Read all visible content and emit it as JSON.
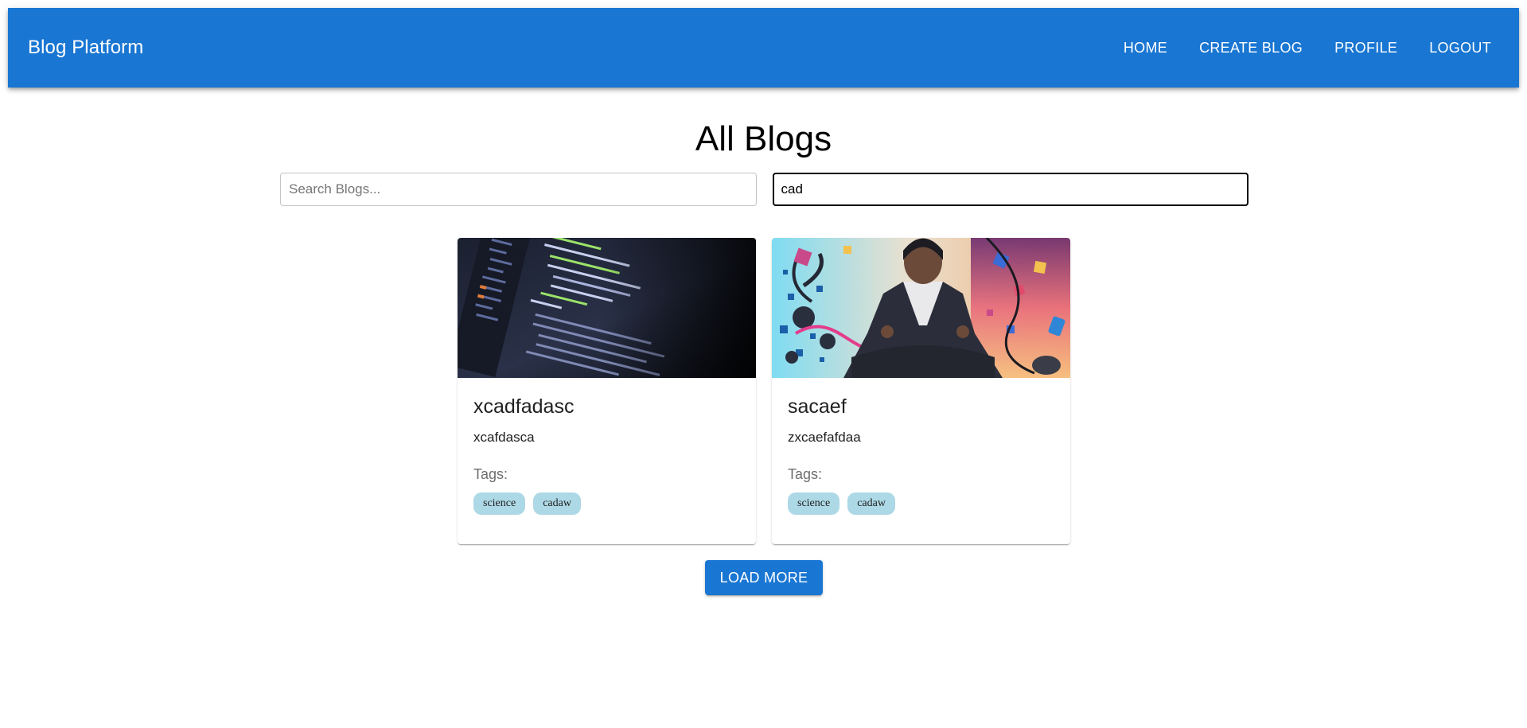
{
  "header": {
    "brand": "Blog Platform",
    "nav": [
      "HOME",
      "CREATE BLOG",
      "PROFILE",
      "LOGOUT"
    ]
  },
  "main": {
    "title": "All Blogs",
    "search": {
      "placeholder": "Search Blogs...",
      "value": ""
    },
    "tag_filter": {
      "value": "cad"
    },
    "tags_label": "Tags:",
    "cards": [
      {
        "title": "xcadfadasc",
        "description": "xcafdasca",
        "image": "code-editor-screen",
        "tags": [
          "science",
          "cadaw"
        ]
      },
      {
        "title": "sacaef",
        "description": "zxcaefafdaa",
        "image": "meditating-person-illustration",
        "tags": [
          "science",
          "cadaw"
        ]
      }
    ],
    "load_more": "LOAD MORE"
  },
  "colors": {
    "primary": "#1976d2",
    "tag_bg": "#add8e6"
  }
}
